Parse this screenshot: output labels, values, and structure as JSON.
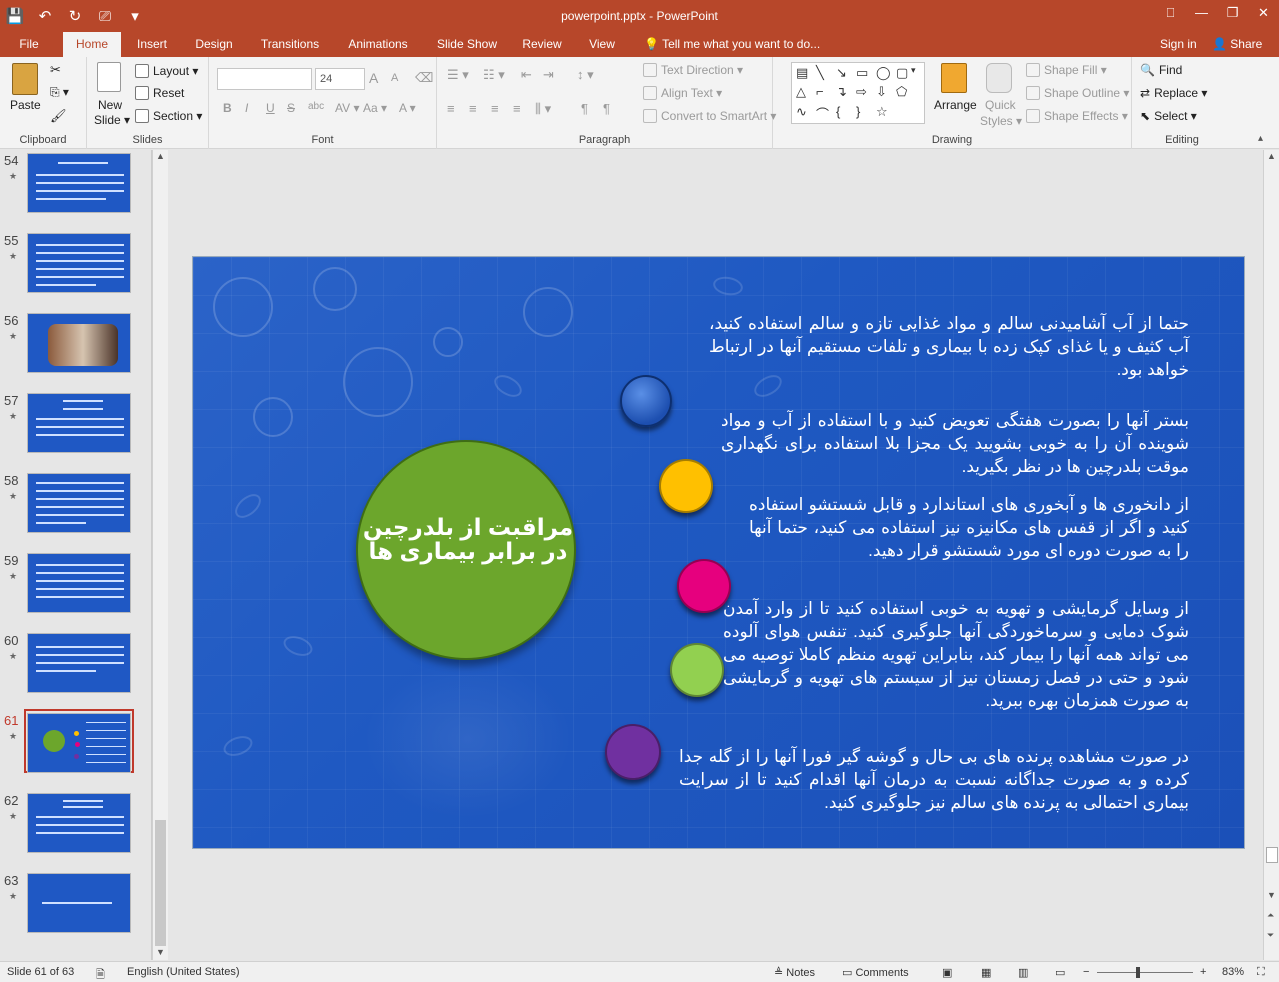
{
  "titlebar": {
    "qat": [
      "💾",
      "↶",
      "↻",
      "⎚",
      "▾"
    ],
    "title": "powerpoint.pptx - PowerPoint",
    "win": [
      "⎕",
      "—",
      "❐",
      "✕"
    ]
  },
  "tabs": {
    "items": [
      "File",
      "Home",
      "Insert",
      "Design",
      "Transitions",
      "Animations",
      "Slide Show",
      "Review",
      "View"
    ],
    "tellme": "Tell me what you want to do...",
    "signin": "Sign in",
    "share": "Share"
  },
  "ribbon": {
    "clipboard": {
      "label": "Clipboard",
      "paste": "Paste"
    },
    "slides": {
      "label": "Slides",
      "new_slide": "New",
      "new_slide2": "Slide ▾",
      "layout": "Layout ▾",
      "reset": "Reset",
      "section": "Section ▾"
    },
    "font": {
      "label": "Font",
      "size": "24",
      "buttons": [
        "B",
        "I",
        "U",
        "S",
        "abc",
        "AV ▾",
        "Aa ▾",
        "A ▾"
      ],
      "grow": "A",
      "shrink": "A"
    },
    "paragraph": {
      "label": "Paragraph",
      "text_direction": "Text Direction ▾",
      "align_text": "Align Text ▾",
      "convert": "Convert to SmartArt ▾"
    },
    "drawing": {
      "label": "Drawing",
      "arrange": "Arrange",
      "quick": "Quick",
      "styles": "Styles ▾",
      "shape_fill": "Shape Fill ▾",
      "shape_outline": "Shape Outline ▾",
      "shape_effects": "Shape Effects ▾"
    },
    "editing": {
      "label": "Editing",
      "find": "Find",
      "replace": "Replace ▾",
      "select": "Select ▾"
    }
  },
  "thumbnails": [
    {
      "num": "54"
    },
    {
      "num": "55"
    },
    {
      "num": "56"
    },
    {
      "num": "57"
    },
    {
      "num": "58"
    },
    {
      "num": "59"
    },
    {
      "num": "60"
    },
    {
      "num": "61"
    },
    {
      "num": "62"
    },
    {
      "num": "63"
    }
  ],
  "slide": {
    "title": "مراقبت از بلدرچین در برابر بیماری ها",
    "paragraphs": [
      "حتما از آب آشامیدنی سالم و مواد غذایی تازه و سالم استفاده کنید، آب کثیف و یا غذای کپک زده با بیماری و تلفات مستقیم آنها در ارتباط خواهد بود.",
      "بستر آنها را بصورت هفتگی تعویض کنید و با استفاده از آب و مواد شوینده آن را به خوبی بشویید یک مجزا بلا استفاده برای نگهداری موقت بلدرچین ها در نظر بگیرید.",
      "از دانخوری ها و آبخوری های استاندارد و قابل شستشو استفاده کنید و اگر از قفس های مکانیزه نیز استفاده می کنید، حتما آنها را به صورت دوره ای مورد شستشو قرار دهید.",
      "از وسایل گرمایشی و تهویه به خوبی استفاده کنید تا از وارد آمدن شوک دمایی و سرماخوردگی آنها جلوگیری کنید. تنفس هوای آلوده می تواند همه آنها را بیمار کند، بنابراین تهویه منظم کاملا توصیه می شود و حتی در فصل زمستان نیز از سیستم های تهویه و گرمایشی به صورت همزمان بهره ببرید.",
      "در صورت مشاهده پرنده های بی حال و گوشه گیر فورا آنها را از گله جدا کرده و به صورت جداگانه نسبت به درمان آنها اقدام کنید تا از سرایت بیماری احتمالی به پرنده های سالم نیز جلوگیری کنید."
    ],
    "colors": {
      "green": "#6ca62c",
      "blue": "#1f59c2",
      "gold": "#ffc000",
      "pink": "#e6007e",
      "lime": "#92d050",
      "purple": "#7030a0"
    }
  },
  "status": {
    "slide": "Slide 61 of 63",
    "language": "English (United States)",
    "notes": "Notes",
    "comments": "Comments",
    "zoom": "83%"
  }
}
